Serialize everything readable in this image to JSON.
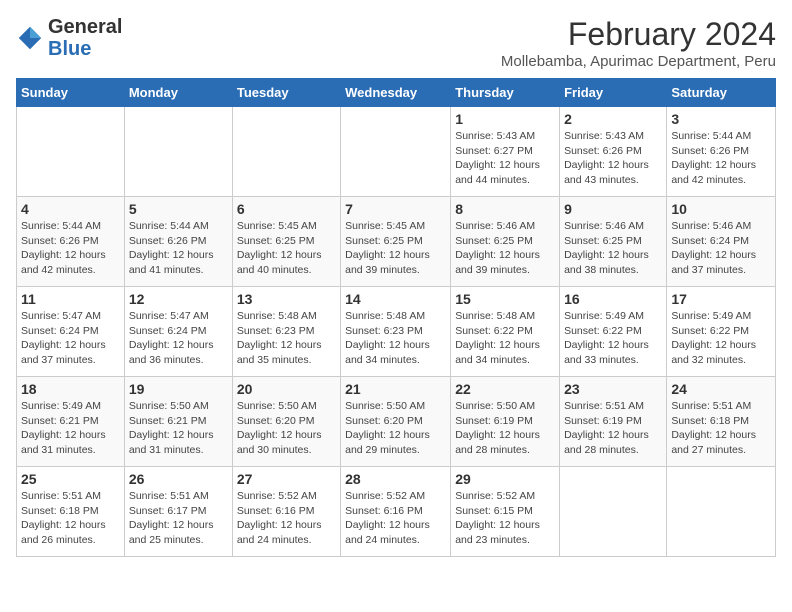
{
  "logo": {
    "general": "General",
    "blue": "Blue"
  },
  "header": {
    "title": "February 2024",
    "subtitle": "Mollebamba, Apurimac Department, Peru"
  },
  "columns": [
    "Sunday",
    "Monday",
    "Tuesday",
    "Wednesday",
    "Thursday",
    "Friday",
    "Saturday"
  ],
  "weeks": [
    [
      {
        "day": "",
        "info": ""
      },
      {
        "day": "",
        "info": ""
      },
      {
        "day": "",
        "info": ""
      },
      {
        "day": "",
        "info": ""
      },
      {
        "day": "1",
        "info": "Sunrise: 5:43 AM\nSunset: 6:27 PM\nDaylight: 12 hours and 44 minutes."
      },
      {
        "day": "2",
        "info": "Sunrise: 5:43 AM\nSunset: 6:26 PM\nDaylight: 12 hours and 43 minutes."
      },
      {
        "day": "3",
        "info": "Sunrise: 5:44 AM\nSunset: 6:26 PM\nDaylight: 12 hours and 42 minutes."
      }
    ],
    [
      {
        "day": "4",
        "info": "Sunrise: 5:44 AM\nSunset: 6:26 PM\nDaylight: 12 hours and 42 minutes."
      },
      {
        "day": "5",
        "info": "Sunrise: 5:44 AM\nSunset: 6:26 PM\nDaylight: 12 hours and 41 minutes."
      },
      {
        "day": "6",
        "info": "Sunrise: 5:45 AM\nSunset: 6:25 PM\nDaylight: 12 hours and 40 minutes."
      },
      {
        "day": "7",
        "info": "Sunrise: 5:45 AM\nSunset: 6:25 PM\nDaylight: 12 hours and 39 minutes."
      },
      {
        "day": "8",
        "info": "Sunrise: 5:46 AM\nSunset: 6:25 PM\nDaylight: 12 hours and 39 minutes."
      },
      {
        "day": "9",
        "info": "Sunrise: 5:46 AM\nSunset: 6:25 PM\nDaylight: 12 hours and 38 minutes."
      },
      {
        "day": "10",
        "info": "Sunrise: 5:46 AM\nSunset: 6:24 PM\nDaylight: 12 hours and 37 minutes."
      }
    ],
    [
      {
        "day": "11",
        "info": "Sunrise: 5:47 AM\nSunset: 6:24 PM\nDaylight: 12 hours and 37 minutes."
      },
      {
        "day": "12",
        "info": "Sunrise: 5:47 AM\nSunset: 6:24 PM\nDaylight: 12 hours and 36 minutes."
      },
      {
        "day": "13",
        "info": "Sunrise: 5:48 AM\nSunset: 6:23 PM\nDaylight: 12 hours and 35 minutes."
      },
      {
        "day": "14",
        "info": "Sunrise: 5:48 AM\nSunset: 6:23 PM\nDaylight: 12 hours and 34 minutes."
      },
      {
        "day": "15",
        "info": "Sunrise: 5:48 AM\nSunset: 6:22 PM\nDaylight: 12 hours and 34 minutes."
      },
      {
        "day": "16",
        "info": "Sunrise: 5:49 AM\nSunset: 6:22 PM\nDaylight: 12 hours and 33 minutes."
      },
      {
        "day": "17",
        "info": "Sunrise: 5:49 AM\nSunset: 6:22 PM\nDaylight: 12 hours and 32 minutes."
      }
    ],
    [
      {
        "day": "18",
        "info": "Sunrise: 5:49 AM\nSunset: 6:21 PM\nDaylight: 12 hours and 31 minutes."
      },
      {
        "day": "19",
        "info": "Sunrise: 5:50 AM\nSunset: 6:21 PM\nDaylight: 12 hours and 31 minutes."
      },
      {
        "day": "20",
        "info": "Sunrise: 5:50 AM\nSunset: 6:20 PM\nDaylight: 12 hours and 30 minutes."
      },
      {
        "day": "21",
        "info": "Sunrise: 5:50 AM\nSunset: 6:20 PM\nDaylight: 12 hours and 29 minutes."
      },
      {
        "day": "22",
        "info": "Sunrise: 5:50 AM\nSunset: 6:19 PM\nDaylight: 12 hours and 28 minutes."
      },
      {
        "day": "23",
        "info": "Sunrise: 5:51 AM\nSunset: 6:19 PM\nDaylight: 12 hours and 28 minutes."
      },
      {
        "day": "24",
        "info": "Sunrise: 5:51 AM\nSunset: 6:18 PM\nDaylight: 12 hours and 27 minutes."
      }
    ],
    [
      {
        "day": "25",
        "info": "Sunrise: 5:51 AM\nSunset: 6:18 PM\nDaylight: 12 hours and 26 minutes."
      },
      {
        "day": "26",
        "info": "Sunrise: 5:51 AM\nSunset: 6:17 PM\nDaylight: 12 hours and 25 minutes."
      },
      {
        "day": "27",
        "info": "Sunrise: 5:52 AM\nSunset: 6:16 PM\nDaylight: 12 hours and 24 minutes."
      },
      {
        "day": "28",
        "info": "Sunrise: 5:52 AM\nSunset: 6:16 PM\nDaylight: 12 hours and 24 minutes."
      },
      {
        "day": "29",
        "info": "Sunrise: 5:52 AM\nSunset: 6:15 PM\nDaylight: 12 hours and 23 minutes."
      },
      {
        "day": "",
        "info": ""
      },
      {
        "day": "",
        "info": ""
      }
    ]
  ]
}
